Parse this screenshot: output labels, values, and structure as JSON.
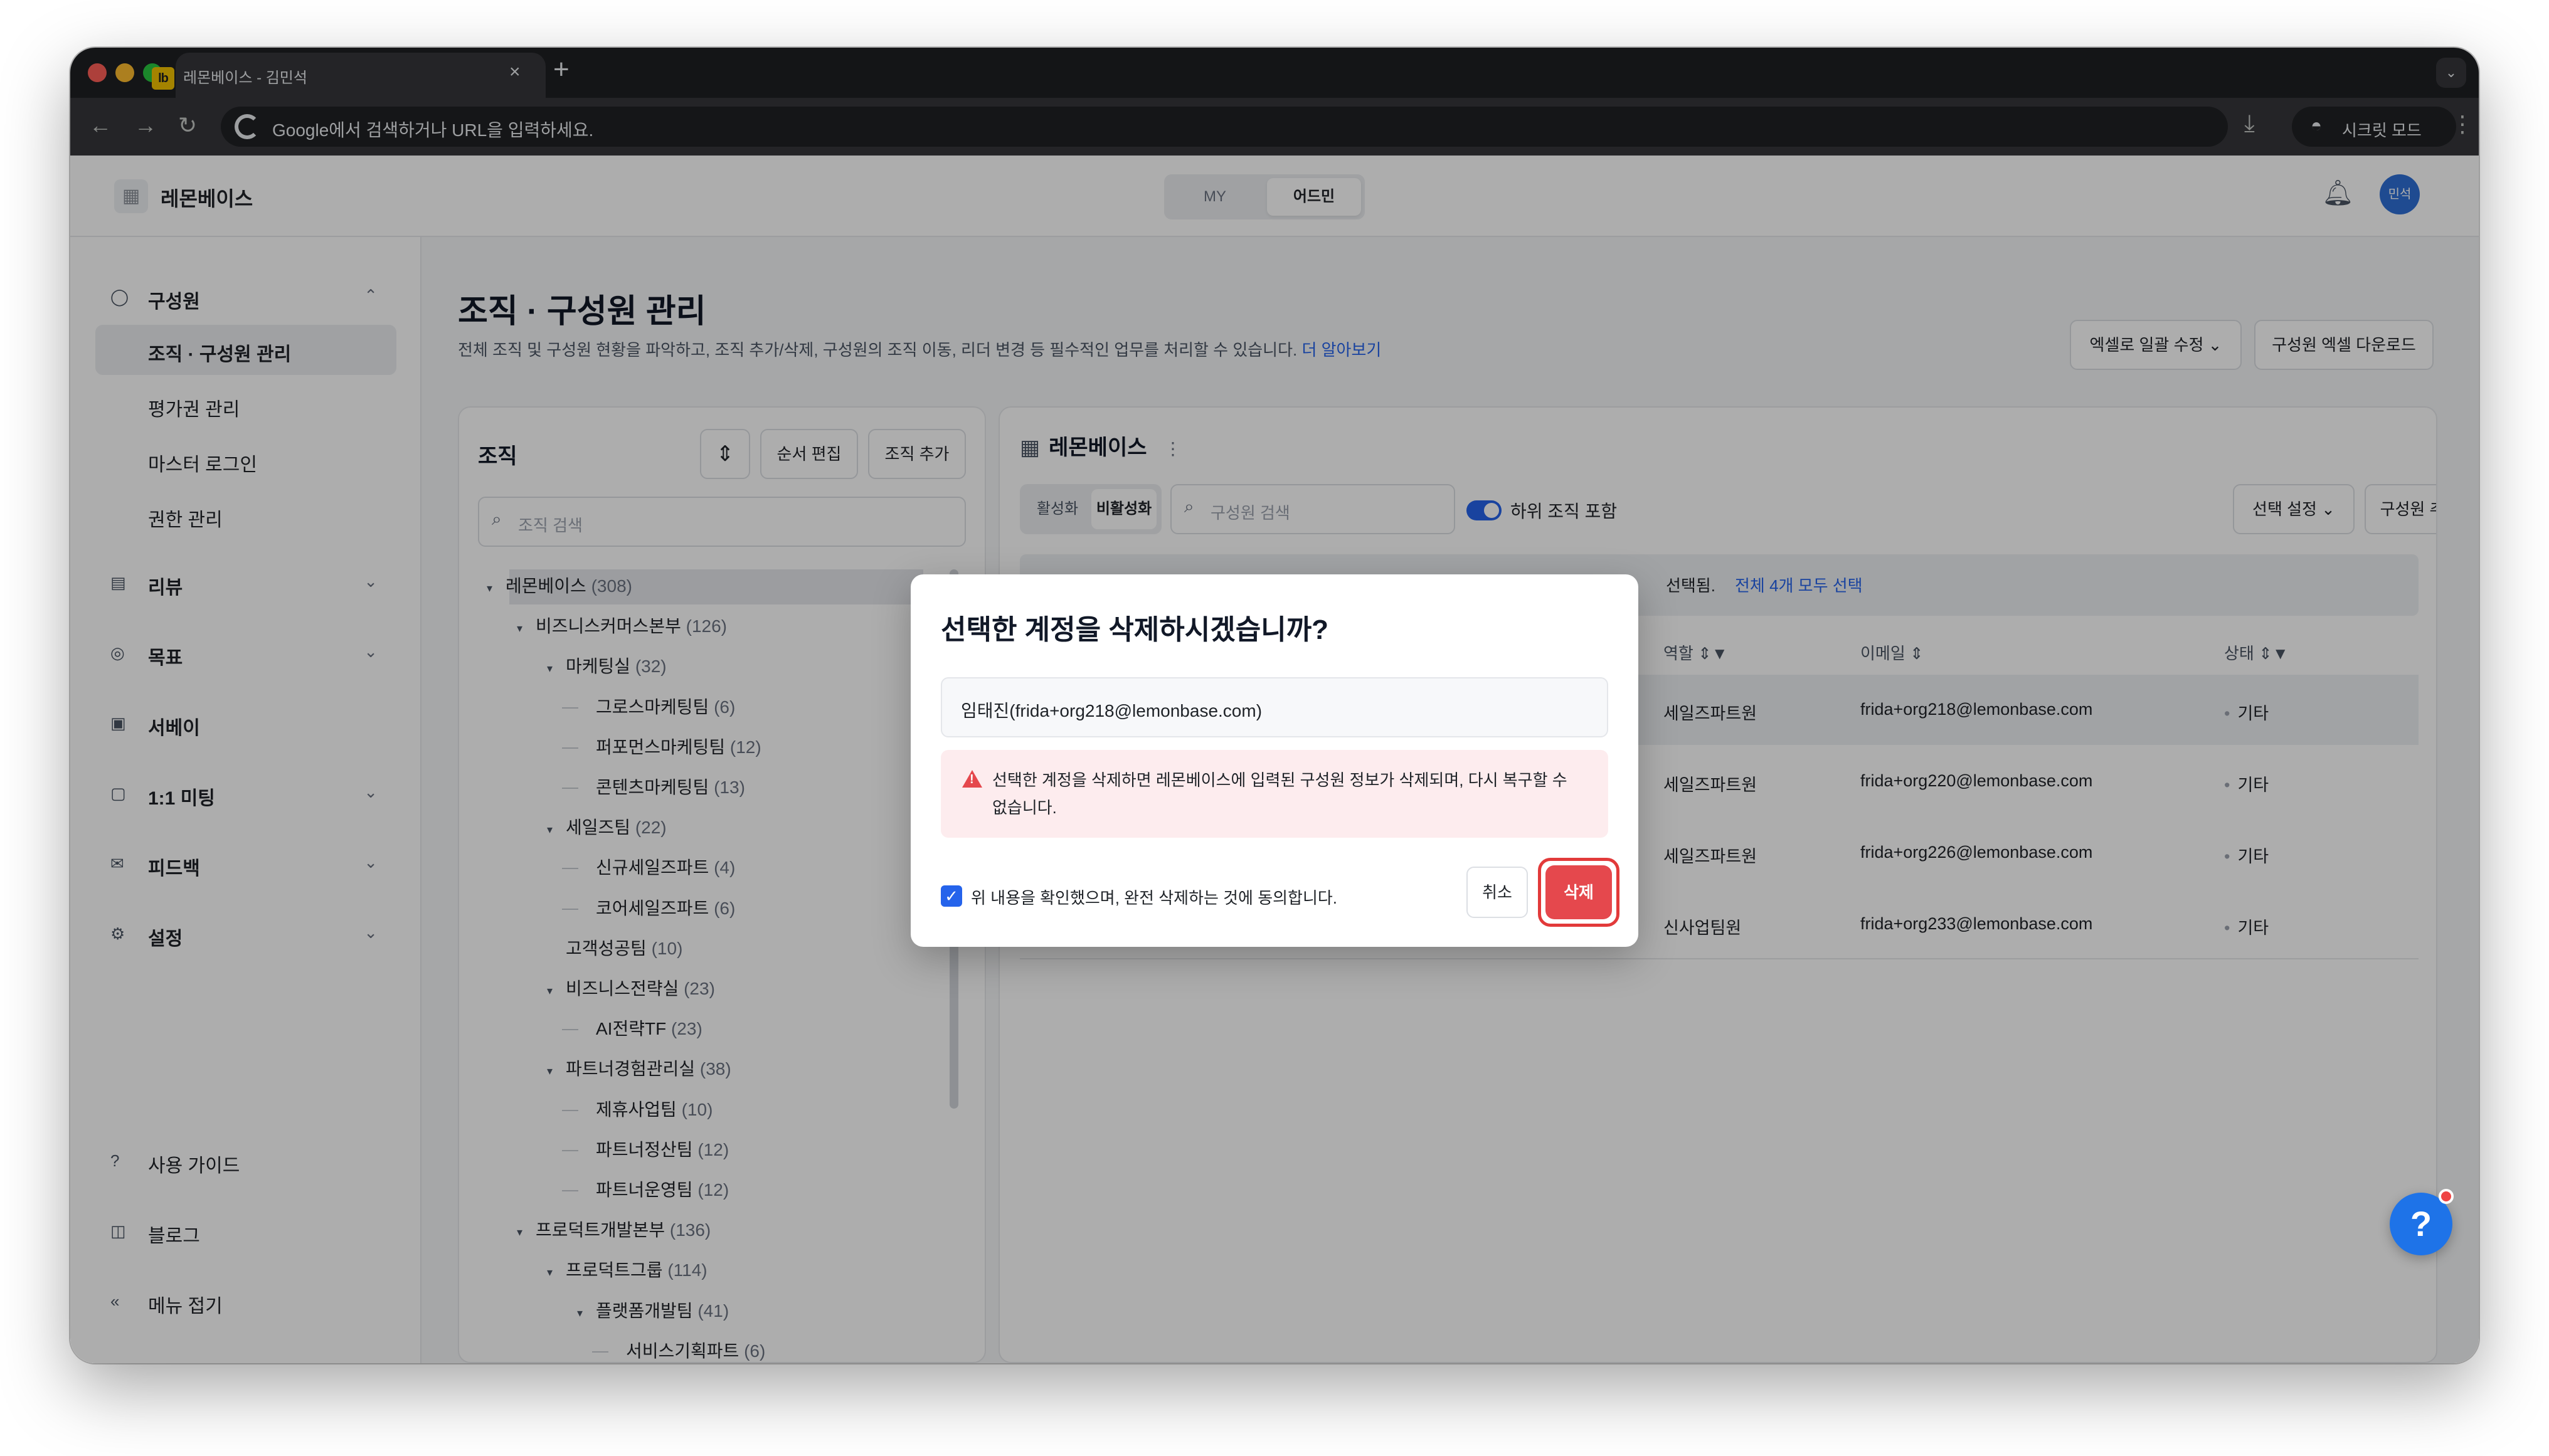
{
  "browser": {
    "tab_title": "레몬베이스 - 김민석",
    "tab_icon": "lb",
    "url_placeholder": "Google에서 검색하거나 URL을 입력하세요.",
    "incognito_label": "시크릿 모드"
  },
  "header": {
    "brand": "레몬베이스",
    "mode_my": "MY",
    "mode_admin": "어드민",
    "avatar": "민석"
  },
  "sidebar": {
    "members_group": "구성원",
    "members_items": [
      "조직 · 구성원 관리",
      "평가권 관리",
      "마스터 로그인",
      "권한 관리"
    ],
    "groups": [
      "리뷰",
      "목표",
      "서베이",
      "1:1 미팅",
      "피드백",
      "설정"
    ],
    "footer": [
      "사용 가이드",
      "블로그",
      "메뉴 접기"
    ]
  },
  "page": {
    "title": "조직 · 구성원 관리",
    "description": "전체 조직 및 구성원 현황을 파악하고, 조직 추가/삭제, 구성원의 조직 이동, 리더 변경 등 필수적인 업무를 처리할 수 있습니다.",
    "learn_more": "더 알아보기",
    "excel_edit": "엑셀로 일괄 수정",
    "excel_download": "구성원 엑셀 다운로드"
  },
  "org_panel": {
    "title": "조직",
    "reorder": "순서 편집",
    "add_org": "조직 추가",
    "search_placeholder": "조직 검색",
    "tree": [
      {
        "name": "레몬베이스",
        "count": "(308)",
        "level": 0,
        "caret": true
      },
      {
        "name": "비즈니스커머스본부",
        "count": "(126)",
        "level": 1,
        "caret": true
      },
      {
        "name": "마케팅실",
        "count": "(32)",
        "level": 2,
        "caret": true
      },
      {
        "name": "그로스마케팅팀",
        "count": "(6)",
        "level": 3,
        "caret": false
      },
      {
        "name": "퍼포먼스마케팅팀",
        "count": "(12)",
        "level": 3,
        "caret": false
      },
      {
        "name": "콘텐츠마케팅팀",
        "count": "(13)",
        "level": 3,
        "caret": false
      },
      {
        "name": "세일즈팀",
        "count": "(22)",
        "level": 2,
        "caret": true
      },
      {
        "name": "신규세일즈파트",
        "count": "(4)",
        "level": 3,
        "caret": false
      },
      {
        "name": "코어세일즈파트",
        "count": "(6)",
        "level": 3,
        "caret": false
      },
      {
        "name": "고객성공팀",
        "count": "(10)",
        "level": 2,
        "caret": false
      },
      {
        "name": "비즈니스전략실",
        "count": "(23)",
        "level": 2,
        "caret": true
      },
      {
        "name": "AI전략TF",
        "count": "(23)",
        "level": 3,
        "caret": false
      },
      {
        "name": "파트너경험관리실",
        "count": "(38)",
        "level": 2,
        "caret": true
      },
      {
        "name": "제휴사업팀",
        "count": "(10)",
        "level": 3,
        "caret": false
      },
      {
        "name": "파트너정산팀",
        "count": "(12)",
        "level": 3,
        "caret": false
      },
      {
        "name": "파트너운영팀",
        "count": "(12)",
        "level": 3,
        "caret": false
      },
      {
        "name": "프로덕트개발본부",
        "count": "(136)",
        "level": 1,
        "caret": true
      },
      {
        "name": "프로덕트그룹",
        "count": "(114)",
        "level": 2,
        "caret": true
      },
      {
        "name": "플랫폼개발팀",
        "count": "(41)",
        "level": 3,
        "caret": true
      },
      {
        "name": "서비스기획파트",
        "count": "(6)",
        "level": 4,
        "caret": false
      }
    ]
  },
  "member_panel": {
    "title": "레몬베이스",
    "tab_active": "활성화",
    "tab_inactive": "비활성화",
    "search_placeholder": "구성원 검색",
    "include_sub": "하위 조직 포함",
    "select_settings": "선택 설정",
    "add_member": "구성원 추가",
    "selected_suffix": "선택됨.",
    "select_all": "전체 4개 모두 선택",
    "columns": {
      "role": "역할",
      "email": "이메일",
      "status": "상태"
    },
    "rows": [
      {
        "role": "세일즈파트원",
        "email": "frida+org218@lemonbase.com",
        "status": "기타"
      },
      {
        "role": "세일즈파트원",
        "email": "frida+org220@lemonbase.com",
        "status": "기타"
      },
      {
        "role": "세일즈파트원",
        "email": "frida+org226@lemonbase.com",
        "status": "기타"
      },
      {
        "role": "신사업팀원",
        "email": "frida+org233@lemonbase.com",
        "status": "기타"
      }
    ]
  },
  "modal": {
    "title": "선택한 계정을 삭제하시겠습니까?",
    "account": "임태진(frida+org218@lemonbase.com)",
    "warning": "선택한 계정을 삭제하면 레몬베이스에 입력된 구성원 정보가 삭제되며, 다시 복구할 수 없습니다.",
    "consent": "위 내용을 확인했으며, 완전 삭제하는 것에 동의합니다.",
    "cancel": "취소",
    "delete": "삭제"
  },
  "colors": {
    "accent": "#2563eb",
    "danger": "#e5484d"
  }
}
